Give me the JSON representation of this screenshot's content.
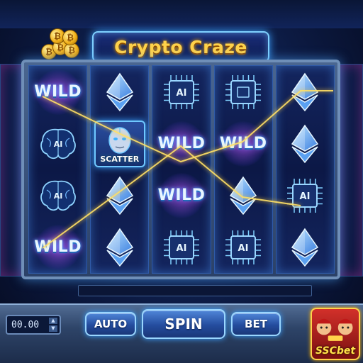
{
  "title": "Crypto Craze",
  "reels": [
    [
      "WILD",
      "ai-brain",
      "ai-brain",
      "WILD"
    ],
    [
      "ethereum",
      "SCATTER",
      "ethereum",
      "ethereum"
    ],
    [
      "ai-chip",
      "WILD",
      "WILD",
      "AI"
    ],
    [
      "ai-chip",
      "WILD",
      "ethereum",
      "AI"
    ],
    [
      "ethereum",
      "ethereum",
      "AI",
      "ethereum"
    ]
  ],
  "symbols": {
    "wild_label": "WILD",
    "scatter_label": "SCATTER",
    "ai_label": "AI"
  },
  "controls": {
    "balance": "00.00",
    "auto_label": "AUTO",
    "spin_label": "SPIN",
    "bet_label": "BET"
  },
  "logo": {
    "text": "SSCbet"
  },
  "coin_symbol": "₿",
  "colors": {
    "title": "#ffd24a",
    "payline": "#ffe066",
    "accent": "#3aa0ff"
  }
}
